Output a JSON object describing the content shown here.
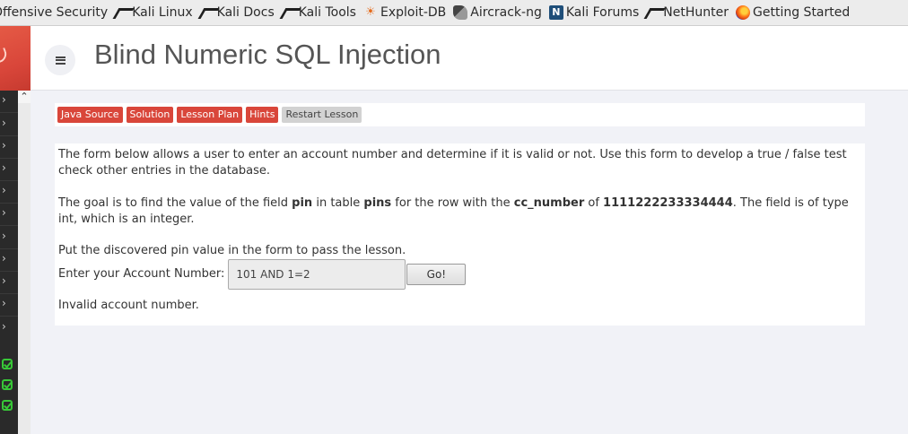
{
  "bookmarks": [
    {
      "label": "Offensive Security",
      "icon": "none"
    },
    {
      "label": "Kali Linux",
      "icon": "kali-dragon-icon"
    },
    {
      "label": "Kali Docs",
      "icon": "kali-dragon-icon"
    },
    {
      "label": "Kali Tools",
      "icon": "kali-dragon-icon"
    },
    {
      "label": "Exploit-DB",
      "icon": "exploit-db-icon"
    },
    {
      "label": "Aircrack-ng",
      "icon": "aircrack-icon"
    },
    {
      "label": "Kali Forums",
      "icon": "kali-forums-icon"
    },
    {
      "label": "NetHunter",
      "icon": "kali-dragon-icon"
    },
    {
      "label": "Getting Started",
      "icon": "firefox-icon"
    }
  ],
  "header": {
    "title": "Blind Numeric SQL Injection",
    "menu_icon": "hamburger-icon"
  },
  "lesson_menu": {
    "java_source": "Java Source",
    "solution": "Solution",
    "lesson_plan": "Lesson Plan",
    "hints": "Hints",
    "restart": "Restart Lesson"
  },
  "content": {
    "intro": "The form below allows a user to enter an account number and determine if it is valid or not. Use this form to develop a true / false test check other entries in the database.",
    "goal_prefix": "The goal is to find the value of the field ",
    "goal_field": "pin",
    "goal_mid1": " in table ",
    "goal_table": "pins",
    "goal_mid2": " for the row with the ",
    "goal_column": "cc_number",
    "goal_mid3": " of ",
    "goal_value": "1111222233334444",
    "goal_suffix": ". The field is of type int, which is an integer.",
    "instruction": "Put the discovered pin value in the form to pass the lesson.",
    "form_label": "Enter your Account Number:",
    "account_value": "101 AND 1=2",
    "go_label": "Go!",
    "result": "Invalid account number."
  },
  "colors": {
    "accent_red": "#d9463a",
    "sidebar_dark": "#2a2a2a",
    "check_green": "#38c838",
    "page_bg": "#f1f2f7"
  }
}
